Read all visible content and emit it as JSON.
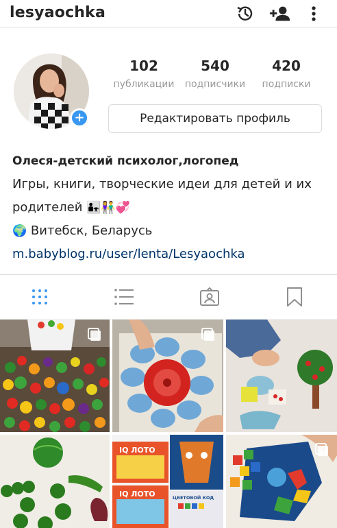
{
  "header": {
    "username": "lesyaochka"
  },
  "profile": {
    "stats": [
      {
        "value": "102",
        "label": "публикации"
      },
      {
        "value": "540",
        "label": "подписчики"
      },
      {
        "value": "420",
        "label": "подписки"
      }
    ],
    "edit_button_label": "Редактировать профиль"
  },
  "bio": {
    "name": "Олеся-детский психолог,логопед",
    "line1": "Игры, книги, творческие идеи для детей и их",
    "line2": "родителей",
    "line2_emoji": "👨‍👧👫💞",
    "location_emoji": "🌍",
    "location": "Витебск, Беларусь",
    "link": "m.babyblog.ru/user/lenta/Lesyaochka"
  },
  "tabs": [
    {
      "name": "grid",
      "active": true
    },
    {
      "name": "list",
      "active": false
    },
    {
      "name": "tagged",
      "active": false
    },
    {
      "name": "saved",
      "active": false
    }
  ],
  "posts": {
    "tile_labels": [
      "IQ ЛОТО",
      "IQ ЛОТО",
      "ЦВЕТОВОЙ КОД"
    ]
  },
  "colors": {
    "accent": "#3897f0",
    "link": "#003569",
    "text": "#262626",
    "muted": "#999999",
    "border": "#dbdbdb"
  }
}
